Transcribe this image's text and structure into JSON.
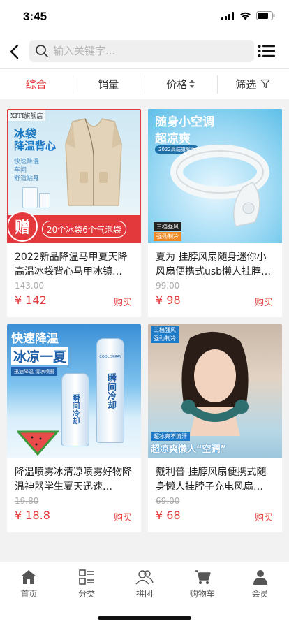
{
  "status": {
    "time": "3:45"
  },
  "search": {
    "placeholder": "输入关键字..."
  },
  "sort_tabs": [
    "综合",
    "销量",
    "价格",
    "筛选"
  ],
  "colors": {
    "accent": "#e4393c"
  },
  "products": [
    {
      "title": "2022新品降温马甲夏天降高温冰袋背心马甲冰镇…",
      "original_price": "143.00",
      "price": "¥ 142",
      "buy": "购买",
      "image": {
        "store": "XITI旗舰店",
        "line1": "冰袋",
        "line2": "降温背心",
        "tag1": "快速降温",
        "tag2": "车间",
        "tag3": "舒适贴身",
        "badge": "赠",
        "banner": "20个冰袋6个气泡袋"
      }
    },
    {
      "title": "夏为 挂脖风扇随身迷你小风扇便携式usb懒人挂脖…",
      "original_price": "99.00",
      "price": "¥ 98",
      "buy": "购买",
      "image": {
        "line1": "随身小空调",
        "line2": "超凉爽",
        "sub": "2022高端旗舰版",
        "tag1": "三档强风",
        "tag2": "强劲制冷"
      }
    },
    {
      "title": "降温喷雾冰清凉喷雾好物降温神器学生夏天迅速…",
      "original_price": "19.80",
      "price": "¥ 18.8",
      "buy": "购买",
      "image": {
        "line1": "快速降温",
        "line2": "冰凉一夏",
        "sub": "迅速降温 清凉喷雾",
        "can": "瞬间冷却",
        "cool": "COOL SPRAY"
      }
    },
    {
      "title": "戴利普 挂脖风扇便携式随身懒人挂脖子充电风扇…",
      "original_price": "69.00",
      "price": "¥ 68",
      "buy": "购买",
      "image": {
        "tag1": "三档强风",
        "tag2": "强劲制冷",
        "tag3": "超冰爽不流汗",
        "line1": "超凉爽懒人“空调”"
      }
    }
  ],
  "nav": [
    {
      "label": "首页",
      "icon": "home-icon"
    },
    {
      "label": "分类",
      "icon": "category-icon"
    },
    {
      "label": "拼团",
      "icon": "group-icon"
    },
    {
      "label": "购物车",
      "icon": "cart-icon"
    },
    {
      "label": "会员",
      "icon": "member-icon"
    }
  ]
}
